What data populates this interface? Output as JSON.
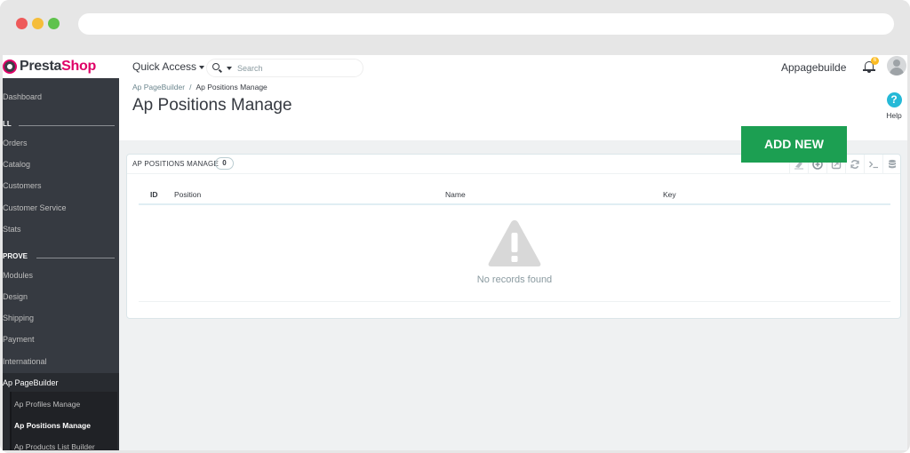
{
  "header": {
    "logo_text": "Presta",
    "logo_accent": "Shop",
    "quick_access_label": "Quick Access",
    "search_placeholder": "Search",
    "shop_name": "Appagebuilde",
    "notification_count": "6"
  },
  "sidebar": {
    "items": [
      {
        "label": "Dashboard"
      },
      {
        "label": "Orders"
      },
      {
        "label": "Catalog"
      },
      {
        "label": "Customers"
      },
      {
        "label": "Customer Service"
      },
      {
        "label": "Stats"
      },
      {
        "label": "Modules"
      },
      {
        "label": "Design"
      },
      {
        "label": "Shipping"
      },
      {
        "label": "Payment"
      },
      {
        "label": "International"
      }
    ],
    "sections": [
      {
        "label": "LL"
      },
      {
        "label": "PROVE"
      }
    ],
    "active_group": {
      "label": "Ap PageBuilder",
      "subitems": [
        {
          "label": "Ap Profiles Manage"
        },
        {
          "label": "Ap Positions Manage"
        },
        {
          "label": "Ap Products List Builder"
        }
      ]
    }
  },
  "page": {
    "breadcrumb": {
      "parent": "Ap PageBuilder",
      "separator": "/",
      "current": "Ap Positions Manage"
    },
    "title": "Ap Positions Manage",
    "help_label": "Help"
  },
  "panel": {
    "title": "AP POSITIONS MANAGE",
    "count": "0",
    "columns": [
      "ID",
      "Position",
      "Name",
      "Key"
    ],
    "empty_text": "No records found",
    "toolbar_icons": [
      "eraser-icon",
      "plus-circle-icon",
      "export-icon",
      "refresh-icon",
      "terminal-icon",
      "database-icon"
    ]
  },
  "add_new_label": "ADD NEW",
  "colors": {
    "brand": "#df0067",
    "sidebar_bg": "#363a41",
    "add_new_bg": "#1c9f52",
    "help_icon": "#25b9d7",
    "badge": "#fbbb22"
  }
}
